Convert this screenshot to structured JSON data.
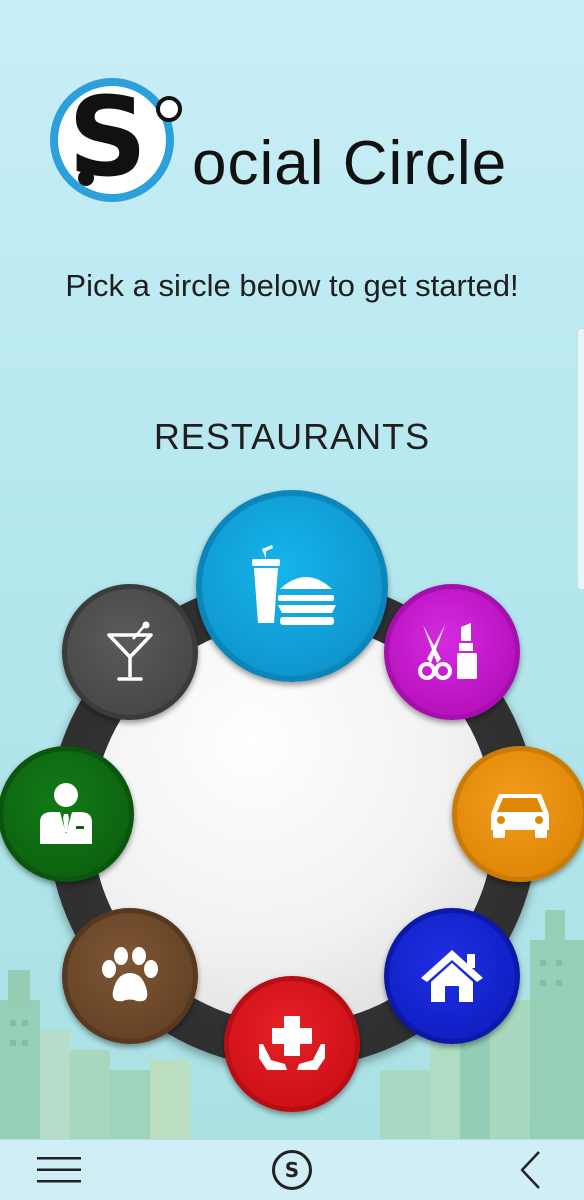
{
  "app": {
    "logo_letter": "S",
    "logo_text": "ocial Circle",
    "tagline": "Pick a sircle below to get started!",
    "selected_category": "RESTAURANTS"
  },
  "circles": [
    {
      "id": "restaurants",
      "icon": "restaurant-icon",
      "color": "#1aa6da"
    },
    {
      "id": "beauty",
      "icon": "beauty-icon",
      "color": "#c21bc9"
    },
    {
      "id": "auto",
      "icon": "car-icon",
      "color": "#e58a0c"
    },
    {
      "id": "home",
      "icon": "house-icon",
      "color": "#1220c8"
    },
    {
      "id": "health",
      "icon": "health-care-icon",
      "color": "#d4131a"
    },
    {
      "id": "pets",
      "icon": "paw-icon",
      "color": "#6e4a2c"
    },
    {
      "id": "professionals",
      "icon": "businessman-icon",
      "color": "#0e6613"
    },
    {
      "id": "nightlife",
      "icon": "cocktail-icon",
      "color": "#4f4f4f"
    }
  ],
  "nav": {
    "menu_icon": "hamburger-menu-icon",
    "home_icon": "social-circle-home-icon",
    "home_label": "S",
    "back_icon": "back-chevron-icon"
  }
}
